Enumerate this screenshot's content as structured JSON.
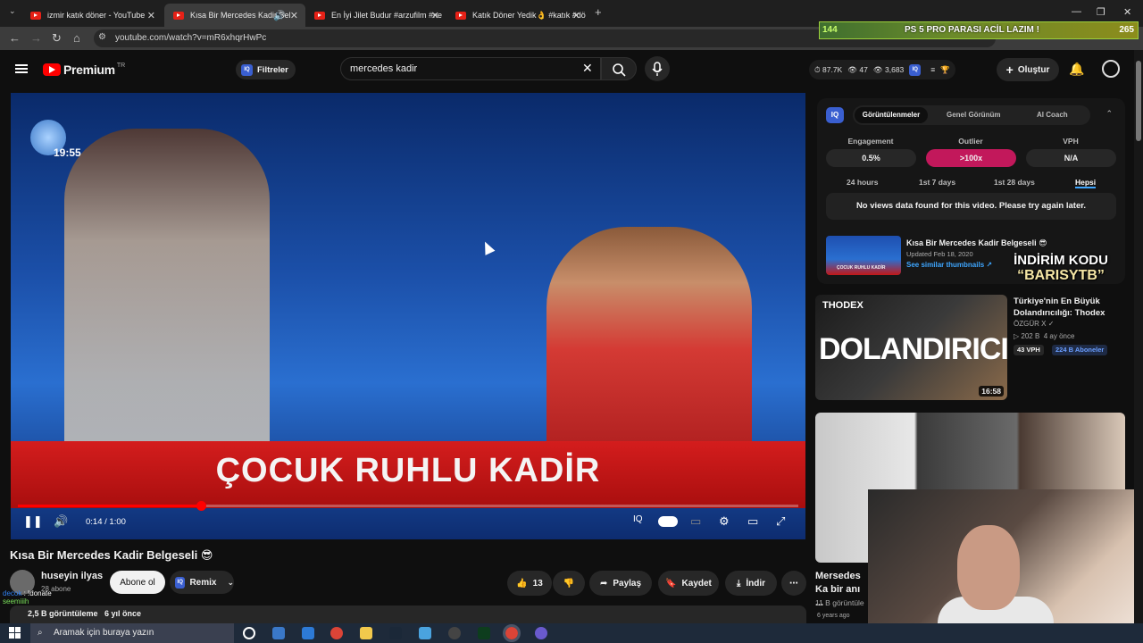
{
  "browser": {
    "tabs": [
      {
        "title": "izmir katık döner - YouTube",
        "active": false
      },
      {
        "title": "Kısa Bir Mercedes Kadir Bel",
        "active": true
      },
      {
        "title": "En İyi Jilet Budur #arzufilm #ne",
        "active": false
      },
      {
        "title": "Katık Döner Yedik👌 #katık #dö",
        "active": false
      }
    ],
    "url": "youtube.com/watch?v=mR6xhqrHwPc"
  },
  "overlay_banner": {
    "left": "144",
    "text": "PS 5 PRO PARASI ACİL LAZIM !",
    "right": "265"
  },
  "youtube": {
    "logo_text": "Premium",
    "region": "TR",
    "filters_label": "Filtreler",
    "search_value": "mercedes kadir",
    "stats": {
      "views": "87.7K",
      "watching": "47",
      "other": "3,683"
    },
    "create_label": "Oluştur"
  },
  "player": {
    "channel_clock": "19:55",
    "caption": "ÇOCUK RUHLU KADİR",
    "time": "0:14 / 1:00",
    "progress": 0.235
  },
  "video": {
    "title": "Kısa Bir Mercedes Kadir Belgeseli 😎",
    "channel": "huseyin ilyas",
    "subs": "28 abone",
    "subscribe_label": "Abone ol",
    "remix_label": "Remix",
    "likes": "13",
    "share_label": "Paylaş",
    "save_label": "Kaydet",
    "download_label": "İndir",
    "views": "2,5 B görüntüleme",
    "age": "6 yıl önce"
  },
  "chat": [
    {
      "user": "decok",
      "text": "!donate"
    },
    {
      "user": "seemiiih",
      "text": ""
    }
  ],
  "iq": {
    "tabs": [
      "Görüntülenmeler",
      "Genel Görünüm",
      "AI Coach"
    ],
    "metrics": [
      {
        "label": "Engagement",
        "value": "0.5%"
      },
      {
        "label": "Outlier",
        "value": ">100x"
      },
      {
        "label": "VPH",
        "value": "N/A"
      }
    ],
    "ranges": [
      "24 hours",
      "1st 7 days",
      "1st 28 days",
      "Hepsi"
    ],
    "no_data": "No views data found for this video. Please try again later.",
    "video_title": "Kısa Bir Mercedes Kadir Belgeseli 😎",
    "updated": "Updated Feb 18, 2020",
    "similar": "See similar thumbnails ↗",
    "thumb_caption": "ÇOCUK RUHLU KADİR"
  },
  "promo": {
    "line1": "İNDİRİM KODU",
    "line2": "“BARISYTB”"
  },
  "recommendations": [
    {
      "brand": "THODEX",
      "thumb_text": "DOLANDIRICI",
      "title": "Türkiye'nin En Büyük Dolandırıcılığı: Thodex",
      "channel": "ÖZGÜR X",
      "views": "202 B",
      "ago": "4 ay önce",
      "vph": "43 VPH",
      "subs": "224 B Aboneler",
      "duration": "16:58"
    },
    {
      "title": "Mersedes Ka bir anı ...",
      "views": "11 B görüntüle",
      "ago": "6 years ago"
    }
  ],
  "taskbar": {
    "search_placeholder": "Aramak için buraya yazın"
  },
  "colors": {
    "accent": "#ff0000",
    "outlier": "#c2185b",
    "link": "#3ea6ff"
  }
}
